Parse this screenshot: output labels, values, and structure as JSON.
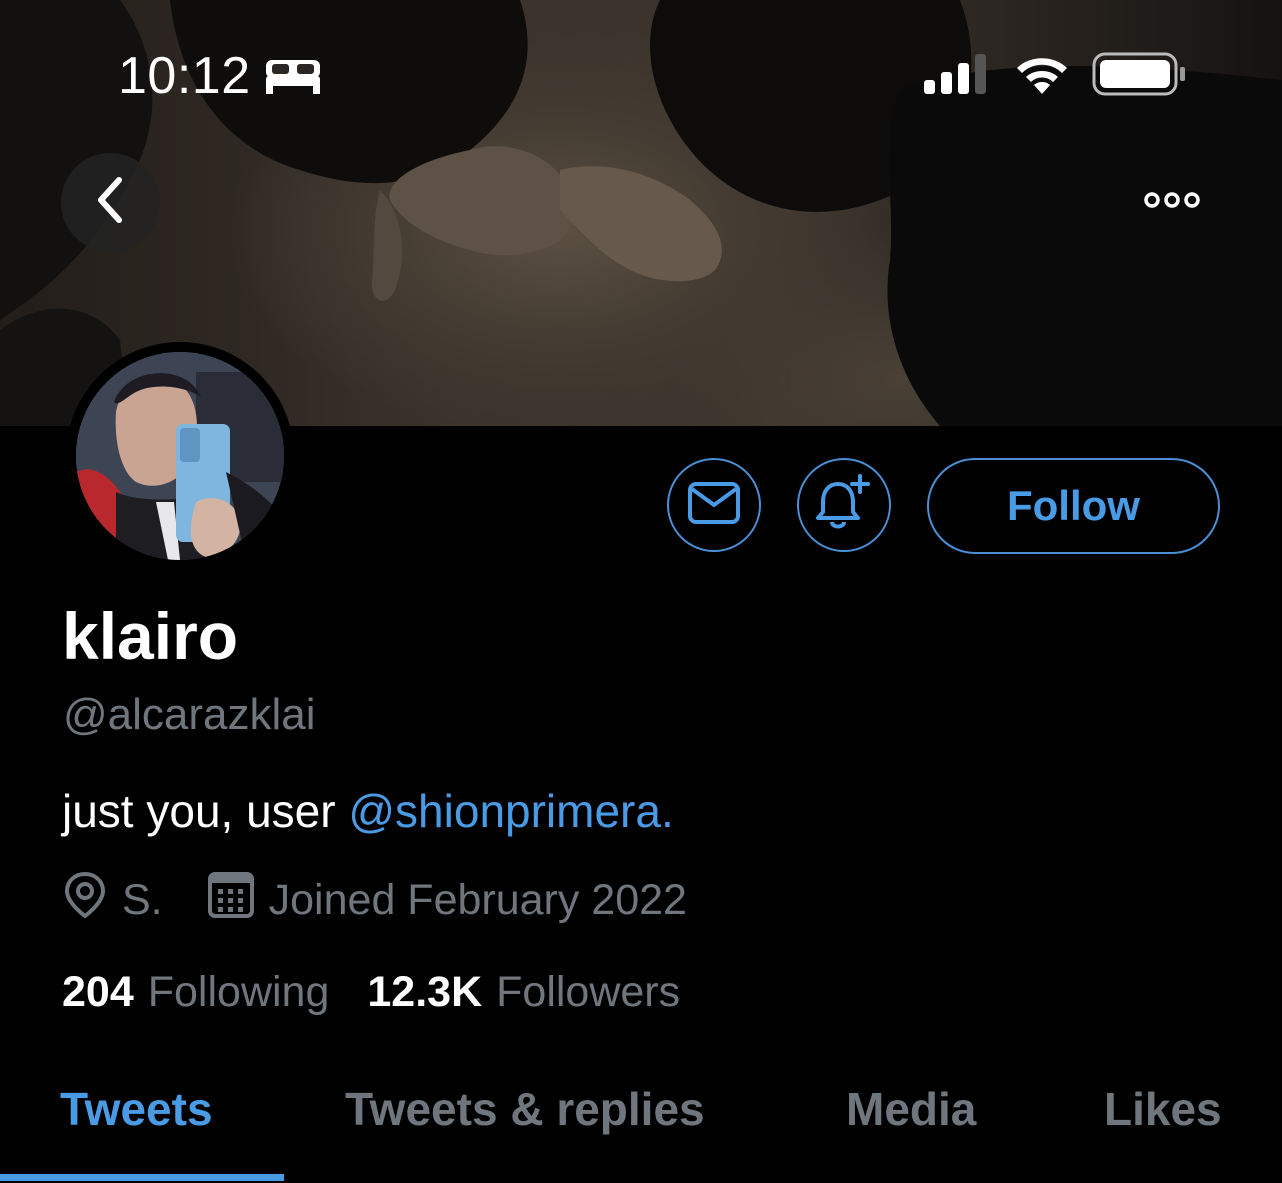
{
  "status_bar": {
    "time": "10:12",
    "icons": [
      "bed-icon",
      "signal-icon",
      "wifi-icon",
      "battery-icon"
    ]
  },
  "nav": {
    "back_icon": "chevron-left-icon",
    "more_icon": "more-horizontal-icon"
  },
  "profile": {
    "display_name": "klairo",
    "handle": "@alcarazklai",
    "bio_text": "just you, user ",
    "bio_mention": "@shionprimera.",
    "location": "S.",
    "joined": "Joined February 2022",
    "following_count": "204",
    "following_label": "Following",
    "followers_count": "12.3K",
    "followers_label": "Followers"
  },
  "actions": {
    "message_icon": "mail-icon",
    "notify_icon": "bell-plus-icon",
    "follow_label": "Follow"
  },
  "tabs": [
    {
      "label": "Tweets",
      "active": true
    },
    {
      "label": "Tweets & replies",
      "active": false
    },
    {
      "label": "Media",
      "active": false
    },
    {
      "label": "Likes",
      "active": false
    }
  ],
  "colors": {
    "accent": "#4a9be6",
    "secondary_text": "#6f767d",
    "background": "#000000"
  }
}
